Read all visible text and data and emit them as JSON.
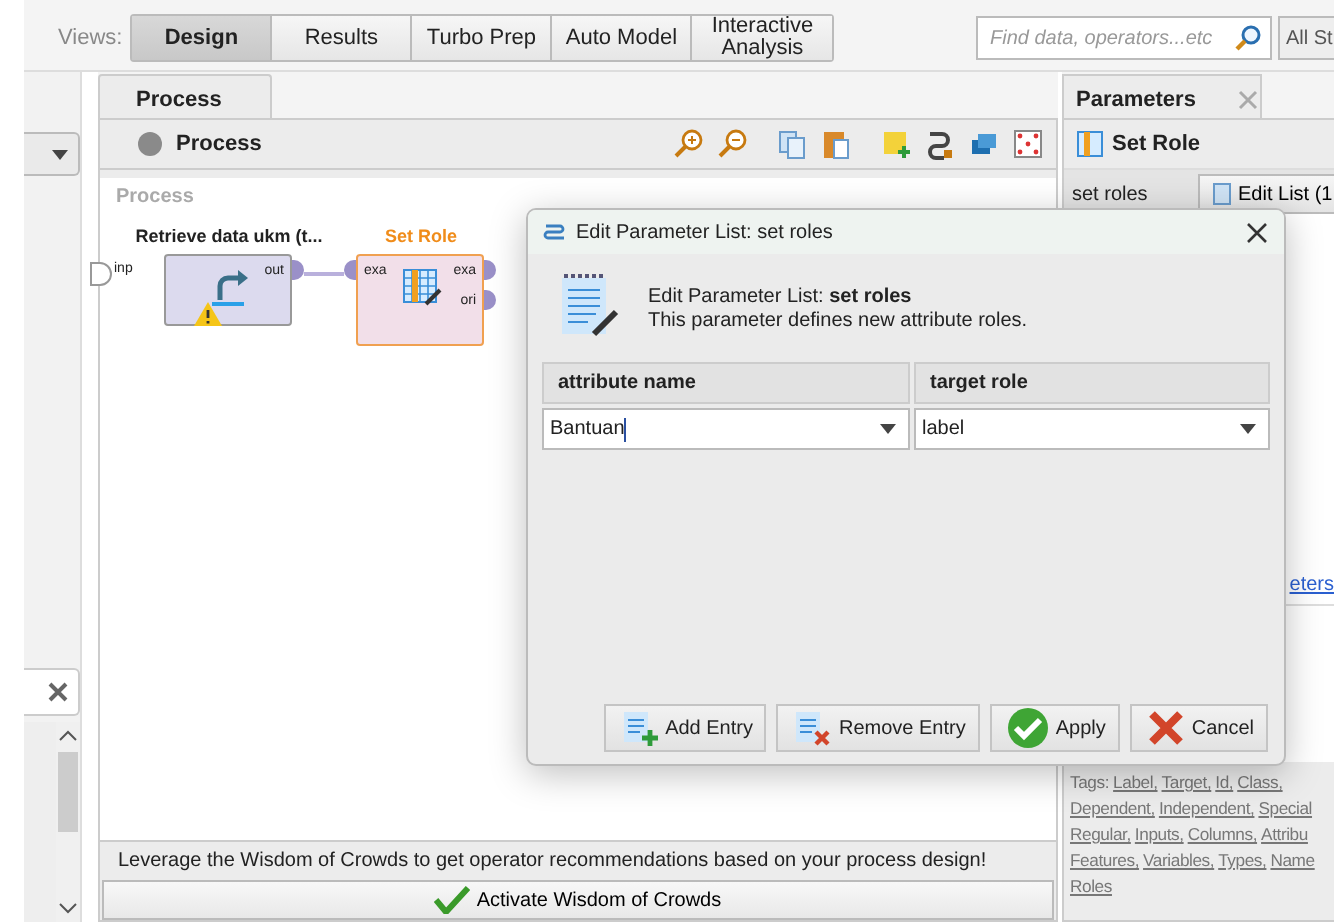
{
  "views_label": "Views:",
  "views": [
    {
      "label": "Design",
      "selected": true
    },
    {
      "label": "Results",
      "selected": false
    },
    {
      "label": "Turbo Prep",
      "selected": false
    },
    {
      "label": "Auto Model",
      "selected": false
    },
    {
      "label": "Interactive Analysis",
      "selected": false
    }
  ],
  "search": {
    "placeholder": "Find data, operators...etc"
  },
  "perspective_button": "All St",
  "process_panel": {
    "tab": "Process",
    "breadcrumb": "Process",
    "canvas_title": "Process",
    "input_port": "inp",
    "operators": [
      {
        "name": "Retrieve data ukm (t...",
        "kind": "retrieve",
        "selected": false,
        "warning": true,
        "outputs": [
          "out"
        ]
      },
      {
        "name": "Set Role",
        "kind": "set_role",
        "selected": true,
        "inputs": [
          "exa"
        ],
        "outputs": [
          "exa",
          "ori"
        ]
      }
    ],
    "wisdom_text": "Leverage the Wisdom of Crowds to get operator recommendations based on your process design!",
    "wisdom_button": "Activate Wisdom of Crowds"
  },
  "parameters_panel": {
    "tab": "Parameters",
    "operator": "Set Role",
    "param_label": "set roles",
    "edit_button": "Edit List (1",
    "link": "eters",
    "tags_label": "Tags:",
    "tag_lines": [
      [
        "Label,",
        "Target,",
        "Id,",
        "Class,"
      ],
      [
        "Dependent,",
        "Independent,",
        "Special"
      ],
      [
        "Regular,",
        "Inputs,",
        "Columns,",
        "Attribu"
      ],
      [
        "Features,",
        "Variables,",
        "Types,",
        "Name"
      ],
      [
        "Roles"
      ]
    ]
  },
  "dialog": {
    "title": "Edit Parameter List: set roles",
    "heading": "Edit Parameter List: **set roles**",
    "description": "This parameter defines new attribute roles.",
    "columns": [
      "attribute name",
      "target role"
    ],
    "rows": [
      {
        "attribute": "Bantuan",
        "role": "label"
      }
    ],
    "buttons": [
      {
        "label": "Add Entry",
        "kind": "add"
      },
      {
        "label": "Remove Entry",
        "kind": "remove"
      },
      {
        "label": "Apply",
        "kind": "apply"
      },
      {
        "label": "Cancel",
        "kind": "cancel"
      }
    ]
  }
}
